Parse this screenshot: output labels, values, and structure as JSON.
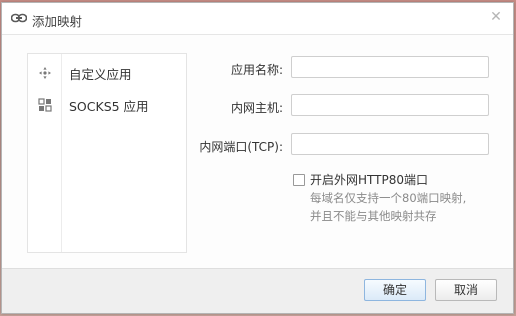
{
  "dialog": {
    "title": "添加映射",
    "close_glyph": "✕"
  },
  "sidebar": {
    "items": [
      {
        "label": "自定义应用",
        "icon": "crosshair-icon"
      },
      {
        "label": "SOCKS5 应用",
        "icon": "grid-icon"
      }
    ]
  },
  "form": {
    "app_name_label": "应用名称:",
    "app_name_value": "",
    "host_label": "内网主机:",
    "host_value": "",
    "port_label": "内网端口(TCP):",
    "port_value": "",
    "http80_label": "开启外网HTTP80端口",
    "http80_checked": false,
    "hint_line1": "每域名仅支持一个80端口映射,",
    "hint_line2": "并且不能与其他映射共存"
  },
  "footer": {
    "ok_label": "确定",
    "cancel_label": "取消"
  },
  "colors": {
    "primary_button_border": "#8eb6df",
    "hint_text": "#8a8a8a"
  }
}
